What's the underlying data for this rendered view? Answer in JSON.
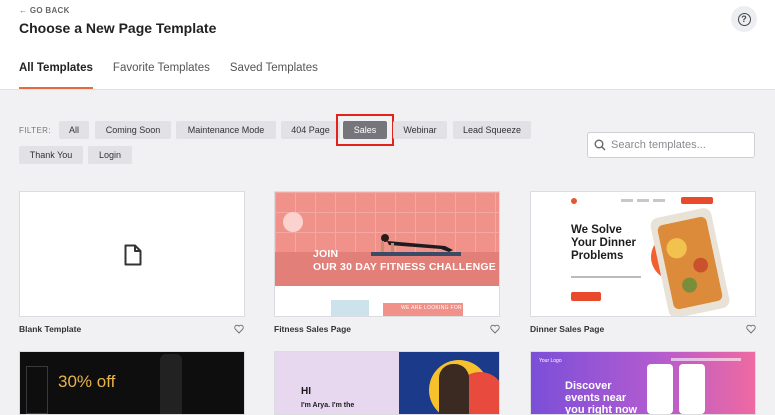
{
  "header": {
    "go_back": "← GO BACK",
    "title": "Choose a New Page Template",
    "tabs": [
      {
        "label": "All Templates",
        "active": true
      },
      {
        "label": "Favorite Templates",
        "active": false
      },
      {
        "label": "Saved Templates",
        "active": false
      }
    ]
  },
  "filter": {
    "label": "FILTER:",
    "chips": [
      {
        "label": "All"
      },
      {
        "label": "Coming Soon"
      },
      {
        "label": "Maintenance Mode"
      },
      {
        "label": "404 Page"
      },
      {
        "label": "Sales",
        "selected": true
      },
      {
        "label": "Webinar"
      },
      {
        "label": "Lead Squeeze"
      },
      {
        "label": "Thank You"
      },
      {
        "label": "Login"
      }
    ]
  },
  "search": {
    "placeholder": "Search templates...",
    "value": ""
  },
  "templates": [
    {
      "name": "Blank Template",
      "thumb": {}
    },
    {
      "name": "Fitness Sales Page",
      "thumb": {
        "headline": "JOIN\nOUR 30 DAY FITNESS CHALLENGE",
        "sub": "WE ARE LOOKING FOR"
      }
    },
    {
      "name": "Dinner Sales Page",
      "thumb": {
        "headline": "We Solve\nYour Dinner\nProblems"
      }
    },
    {
      "name": "",
      "thumb": {
        "headline": "30% off"
      }
    },
    {
      "name": "",
      "thumb": {
        "headline": "HI",
        "sub": "I'm Arya. I'm the"
      }
    },
    {
      "name": "",
      "thumb": {
        "logo": "Your Logo",
        "headline": "Discover\nevents near\nyou right now"
      }
    }
  ],
  "colors": {
    "accent": "#e26c3e",
    "highlight": "#e2221b",
    "chip_selected": "#76757b"
  },
  "icons": {
    "help": "help-icon",
    "search": "search-icon",
    "favorite": "heart-icon",
    "blank": "file-icon"
  }
}
